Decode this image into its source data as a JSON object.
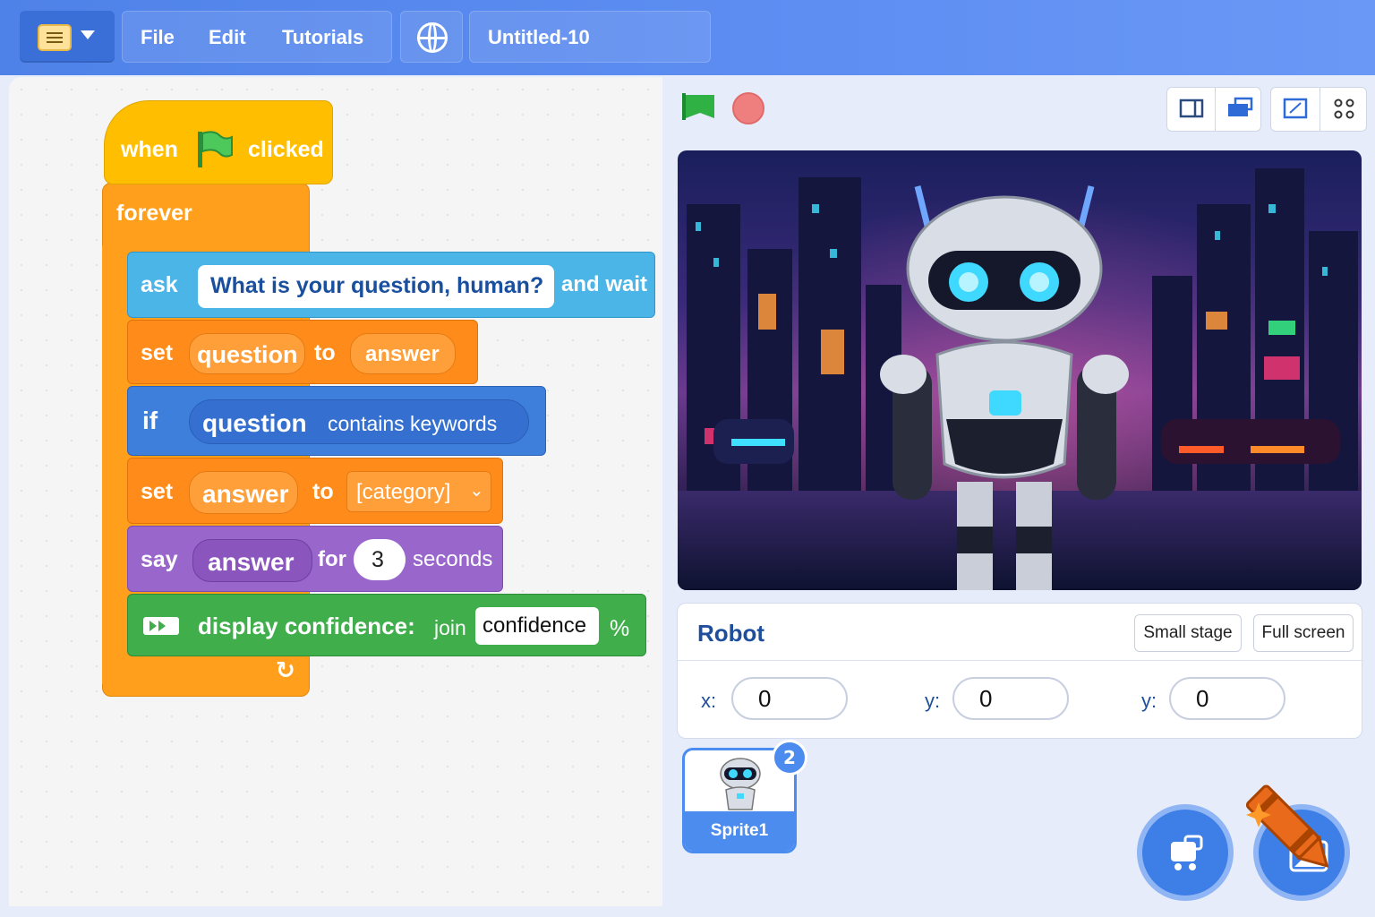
{
  "menubar": {
    "file": "File",
    "edit": "Edit",
    "tutorials": "Tutorials",
    "project_title": "Untitled-10"
  },
  "icons": {
    "menu": "menu-icon",
    "globe": "globe-icon",
    "green_flag": "green-flag-icon",
    "stop": "stop-icon",
    "crayon": "crayon-icon"
  },
  "colors": {
    "topbar": "#5a8bf0",
    "events": "#ffbf00",
    "control": "#ff9f1c",
    "sensing": "#4cb5e8",
    "operators_blue": "#3f7fdc",
    "looks": "#9966cc",
    "extension": "#3fae4b"
  },
  "script": {
    "hat": {
      "when": "when",
      "clicked": "clicked"
    },
    "forever": "forever",
    "ask": {
      "keyword": "ask",
      "question": "What is your question, human?",
      "suffix": "and wait"
    },
    "set1": {
      "keyword": "set",
      "variable": "question",
      "to": "to",
      "value": "answer"
    },
    "if": {
      "keyword": "if",
      "reporter": "question",
      "condition": "contains keywords"
    },
    "set2": {
      "keyword": "set",
      "variable": "answer",
      "to": "to",
      "value": "[category]"
    },
    "say": {
      "keyword": "say",
      "reporter": "answer",
      "for": "for",
      "secs": "3",
      "seconds": "seconds"
    },
    "display": {
      "label": "display confidence:",
      "join": "join",
      "value": "confidence",
      "percent": "%"
    }
  },
  "sprite_info": {
    "name": "Robot",
    "small_stage": "Small stage",
    "full_screen": "Full screen",
    "x_label": "x:",
    "x_value": "0",
    "y_label": "y:",
    "y_value": "0",
    "y2_label": "y:",
    "y2_value": "0"
  },
  "sprites": [
    {
      "name": "Sprite1",
      "badge": "2"
    }
  ]
}
